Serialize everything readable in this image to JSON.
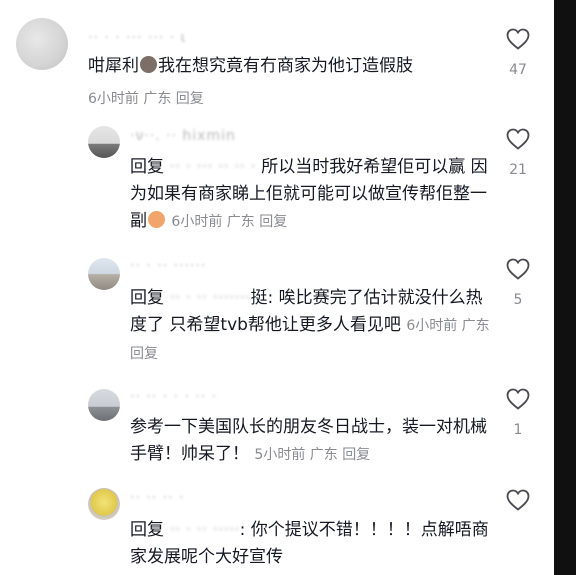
{
  "comments": [
    {
      "username": "·· · · ··· ··· · ι",
      "text": "咁犀利",
      "text_after_emoji": "我在想究竟有冇商家为他订造假肢",
      "meta": "6小时前 广东 回复",
      "likes": "47"
    },
    {
      "username": "·ν··. ·· hixmin",
      "reply_kw": "回复",
      "mention": "·· · ··· ·· ·· ·",
      "text": "所以当时我好希望佢可以赢 因为如果有商家睇上佢就可能可以做宣传帮佢整一副",
      "meta": "6小时前 广东 回复",
      "likes": "21"
    },
    {
      "username": "·· · ·· ······",
      "reply_kw": "回复",
      "mention": "·· · ·· ·······",
      "text": "挺: 唉比赛完了估计就没什么热度了 只希望tvb帮他让更多人看见吧",
      "meta": "6小时前 广东 回复",
      "likes": "5"
    },
    {
      "username": "·· ·· · · · ·· ·",
      "text": "参考一下美国队长的朋友冬日战士，装一对机械手臂！帅呆了！",
      "meta": "5小时前 广东 回复",
      "likes": "1"
    },
    {
      "username": "·· ·· ·· ·",
      "reply_kw": "回复",
      "mention": "·· · ·· ·····",
      "text": ": 你个提议不错！！！！点解唔商家发展呢个大好宣传",
      "meta": "",
      "likes": ""
    }
  ]
}
